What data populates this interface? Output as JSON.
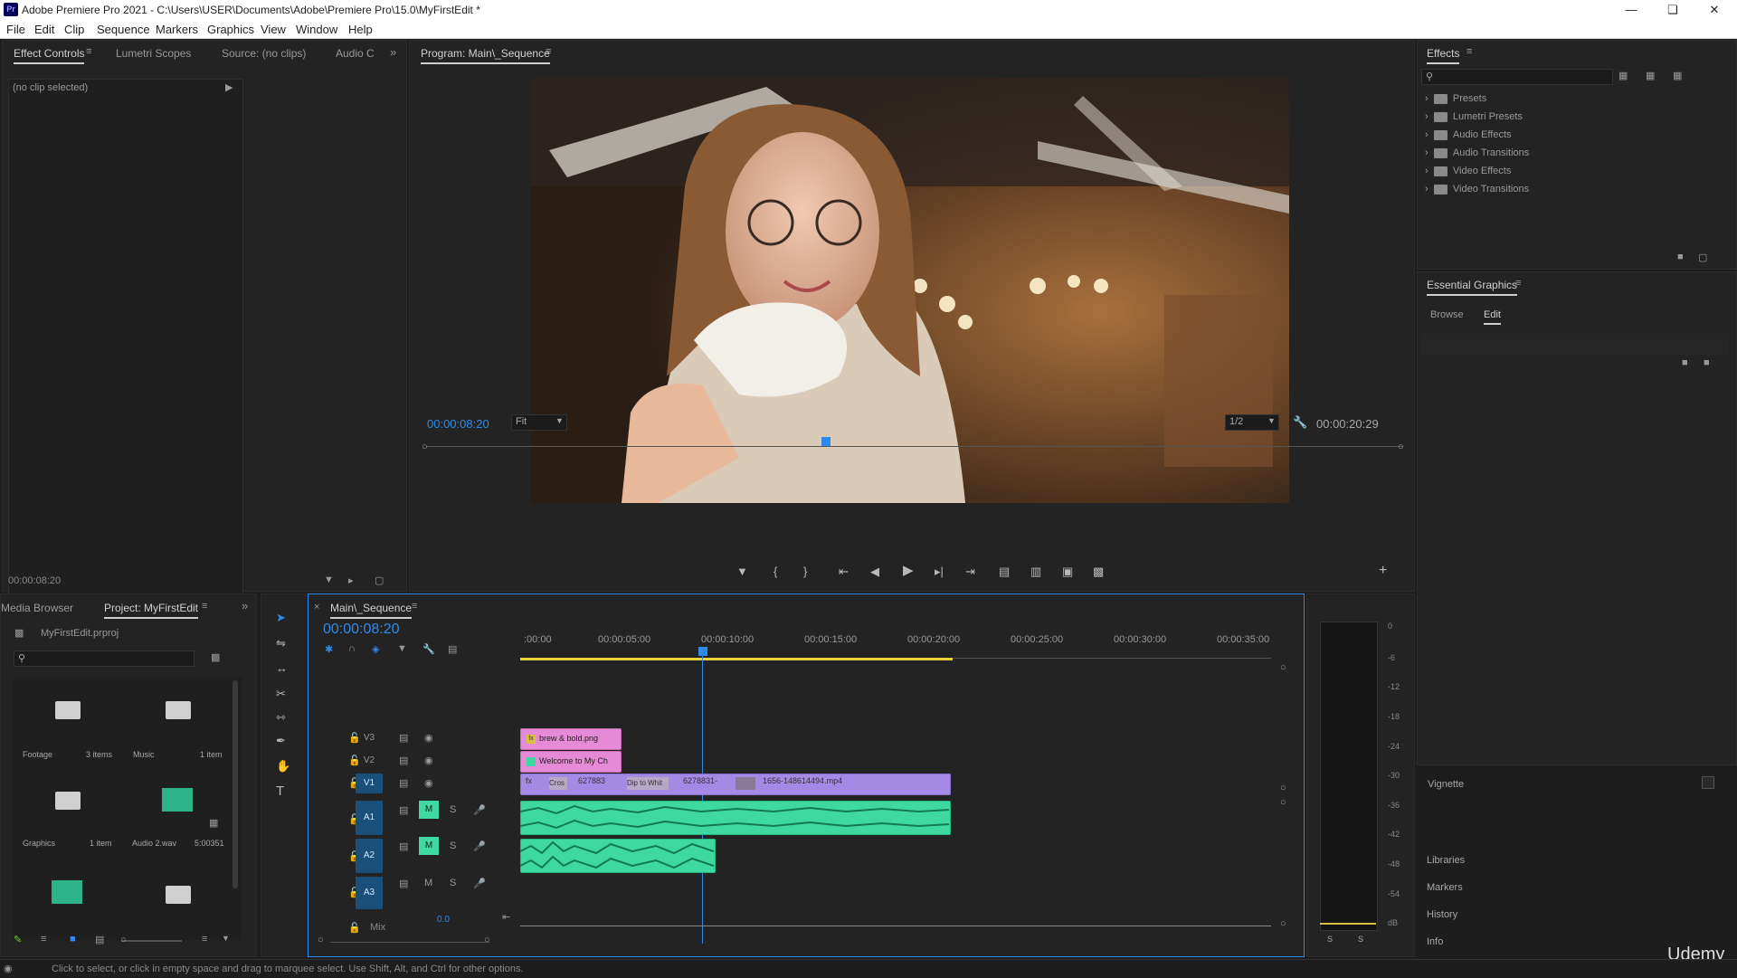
{
  "app": {
    "title": "Adobe Premiere Pro 2021 - C:\\Users\\USER\\Documents\\Adobe\\Premiere Pro\\15.0\\MyFirstEdit *",
    "logo": "Pr",
    "window_controls": [
      "minimize-icon",
      "restore-icon",
      "close-icon"
    ]
  },
  "menu": [
    "File",
    "Edit",
    "Clip",
    "Sequence",
    "Markers",
    "Graphics",
    "View",
    "Window",
    "Help"
  ],
  "source_panel": {
    "tabs": [
      "Effect Controls",
      "Lumetri Scopes",
      "Source: (no clips)",
      "Audio C"
    ],
    "active_tab": "Effect Controls",
    "no_clip": "(no clip selected)",
    "timecode": "00:00:08:20"
  },
  "program_monitor": {
    "tab": "Program: Main\\_Sequence",
    "timecode": "00:00:08:20",
    "fit": "Fit",
    "resolution": "1/2",
    "duration": "00:00:20:29",
    "playhead_fraction": 0.409
  },
  "effects_panel": {
    "tab": "Effects",
    "items": [
      "Presets",
      "Lumetri Presets",
      "Audio Effects",
      "Audio Transitions",
      "Video Effects",
      "Video Transitions"
    ]
  },
  "essential_graphics": {
    "tab": "Essential Graphics",
    "subtabs": [
      "Browse",
      "Edit"
    ],
    "active_subtab": "Edit"
  },
  "right_bottom": {
    "vignette": "Vignette",
    "items": [
      "Libraries",
      "Markers",
      "History",
      "Info"
    ],
    "watermark": "Udemy"
  },
  "project_panel": {
    "tabs": [
      "Media Browser",
      "Project: MyFirstEdit"
    ],
    "active_tab": "Project: MyFirstEdit",
    "file": "MyFirstEdit.prproj",
    "bins": [
      {
        "name": "Footage",
        "count": "3 items",
        "kind": "folder"
      },
      {
        "name": "Music",
        "count": "1 item",
        "kind": "folder"
      },
      {
        "name": "Graphics",
        "count": "1 item",
        "kind": "folder"
      },
      {
        "name": "Audio 2.wav",
        "count": "5:00351",
        "kind": "audio"
      },
      {
        "name": "",
        "count": "",
        "kind": "audio"
      },
      {
        "name": "",
        "count": "",
        "kind": "folder"
      }
    ]
  },
  "timeline": {
    "tab": "Main\\_Sequence",
    "timecode": "00:00:08:20",
    "ruler": [
      ":00:00",
      "00:00:05:00",
      "00:00:10:00",
      "00:00:15:00",
      "00:00:20:00",
      "00:00:25:00",
      "00:00:30:00",
      "00:00:35:00"
    ],
    "video_tracks": [
      "V3",
      "V2",
      "V1"
    ],
    "audio_tracks": [
      "A1",
      "A2",
      "A3"
    ],
    "mix_label": "Mix",
    "mix_value": "0.0",
    "clips": {
      "v3": "brew & bold.png",
      "v2": "Welcome to My Ch",
      "v1_a": "Cros",
      "v1_b": "627883",
      "v1_c": "Dip to Whit",
      "v1_d": "6278831-",
      "v1_e": "1656-148614494.mp4"
    }
  },
  "audio_meter": {
    "scale": [
      "0",
      "-6",
      "-12",
      "-18",
      "-24",
      "-30",
      "-36",
      "-42",
      "-48",
      "-54",
      "dB"
    ],
    "solo": [
      "S",
      "S"
    ]
  },
  "status": "Click to select, or click in empty space and drag to marquee select. Use Shift, Alt, and Ctrl for other options.",
  "colors": {
    "accent_blue": "#2d8ceb",
    "clip_pink": "#e58ad6",
    "clip_purple": "#a58ae5",
    "clip_green": "#3dd9a0",
    "work_area": "#e8d43a"
  }
}
